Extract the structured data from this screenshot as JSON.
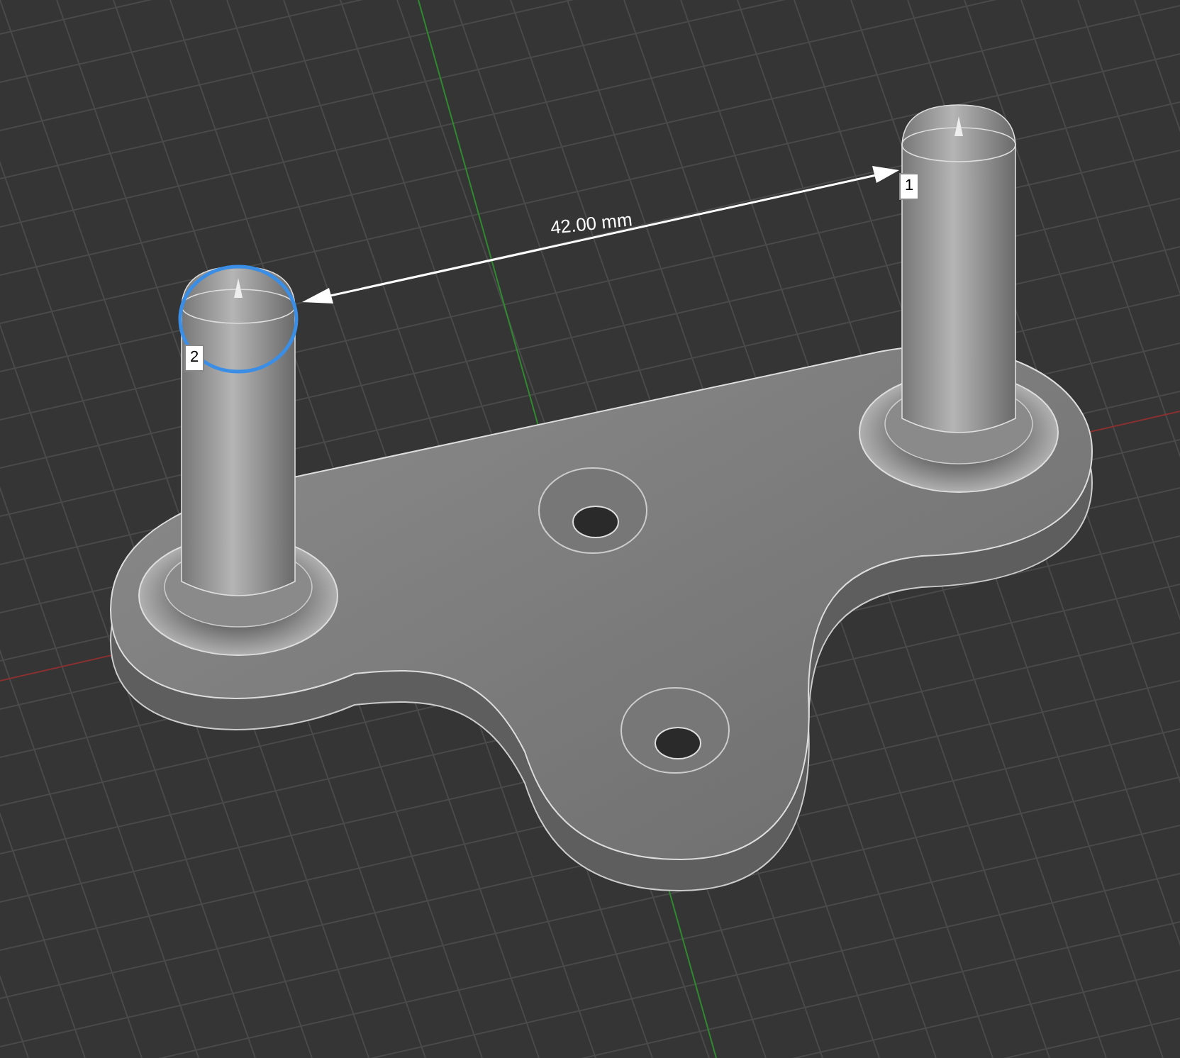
{
  "viewport": {
    "dimension": {
      "label": "42.00 mm"
    },
    "markers": [
      {
        "label": "1",
        "selected": false
      },
      {
        "label": "2",
        "selected": true
      }
    ]
  }
}
